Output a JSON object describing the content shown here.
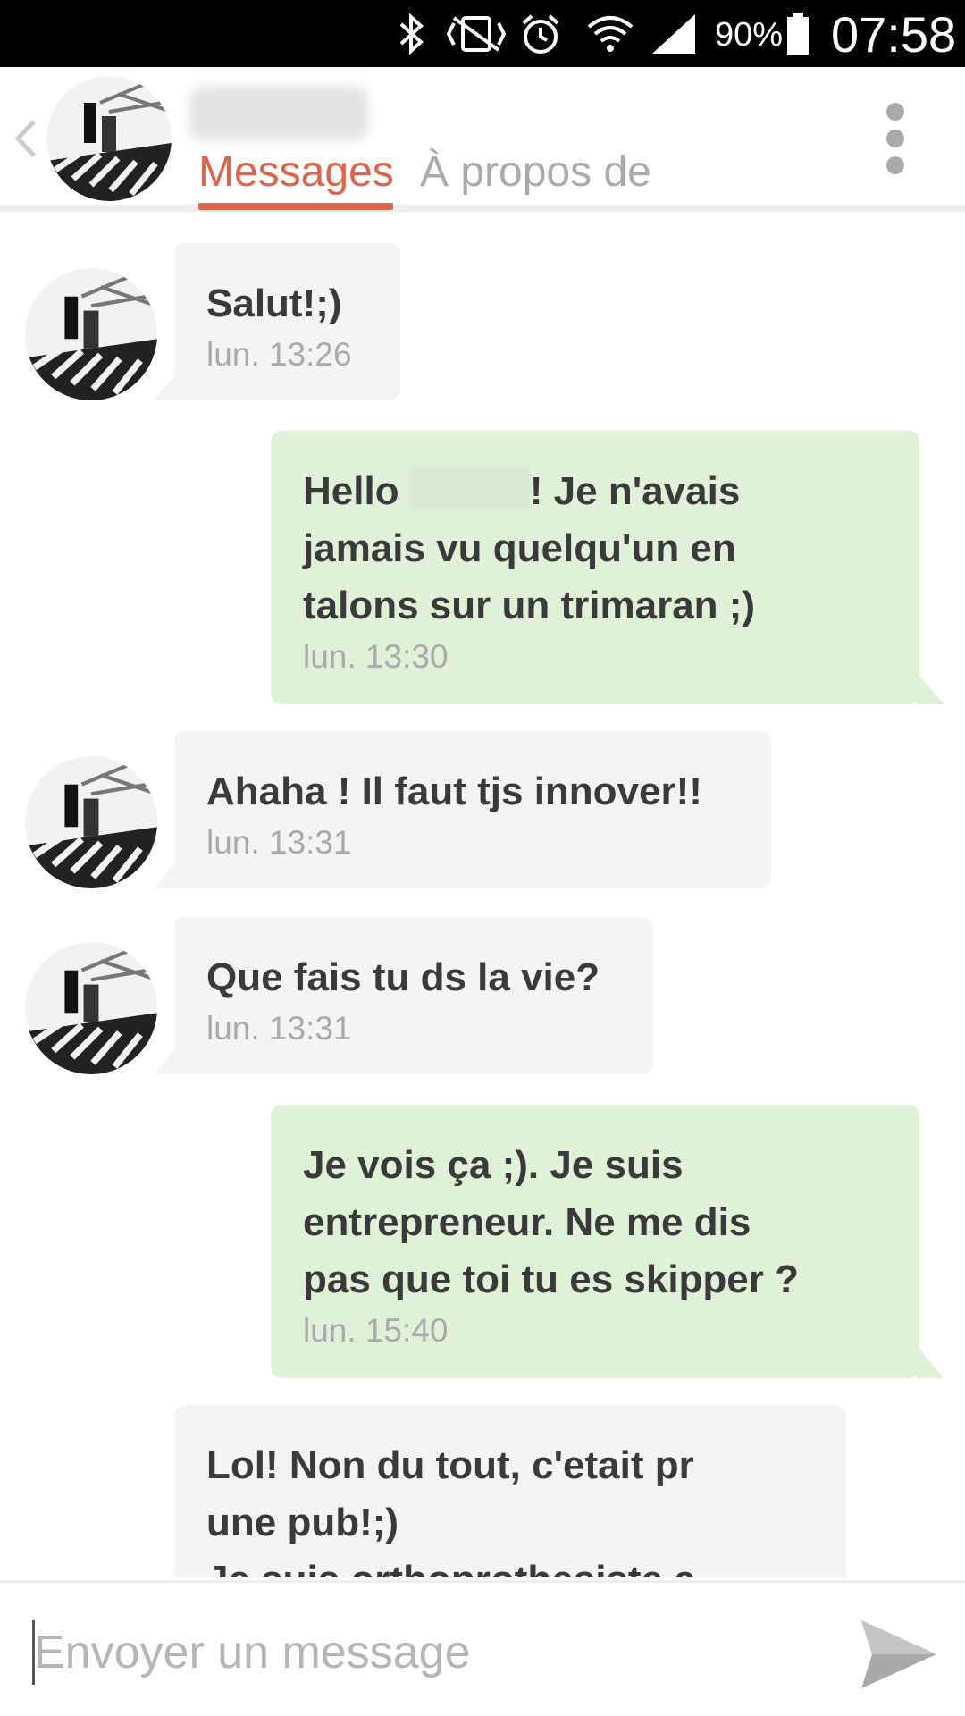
{
  "status_bar": {
    "icons": [
      "bluetooth-icon",
      "vibrate-icon",
      "alarm-icon",
      "wifi-icon",
      "signal-icon",
      "battery-icon"
    ],
    "battery": "90%",
    "time": "07:58"
  },
  "header": {
    "tabs": [
      {
        "label": "Messages",
        "active": true
      },
      {
        "label": "À propos de",
        "active": false
      }
    ],
    "accent": "#e0644c"
  },
  "messages": [
    {
      "direction": "in",
      "text": "Salut!;)",
      "time": "lun.  13:26"
    },
    {
      "direction": "out",
      "text_before": "Hello ",
      "text_after": "! Je n'avais\njamais vu quelqu'un en\ntalons sur un trimaran ;)",
      "time": "lun.  13:30"
    },
    {
      "direction": "in",
      "text": "Ahaha ! Il faut tjs innover!!",
      "time": "lun.  13:31"
    },
    {
      "direction": "in",
      "text": "Que fais tu ds la vie?",
      "time": "lun.  13:31"
    },
    {
      "direction": "out",
      "text": "Je vois ça ;). Je suis\nentrepreneur. Ne me dis\npas que toi tu es skipper ?",
      "time": "lun.  15:40"
    },
    {
      "direction": "in",
      "text": "Lol! Non du tout, c'etait pr\nune pub!;)\nJe suis orthoprothesiste a",
      "time": ""
    }
  ],
  "composer": {
    "placeholder": "Envoyer un message"
  },
  "colors": {
    "incoming_bubble": "#f4f4f4",
    "outgoing_bubble": "#dff2d8"
  }
}
